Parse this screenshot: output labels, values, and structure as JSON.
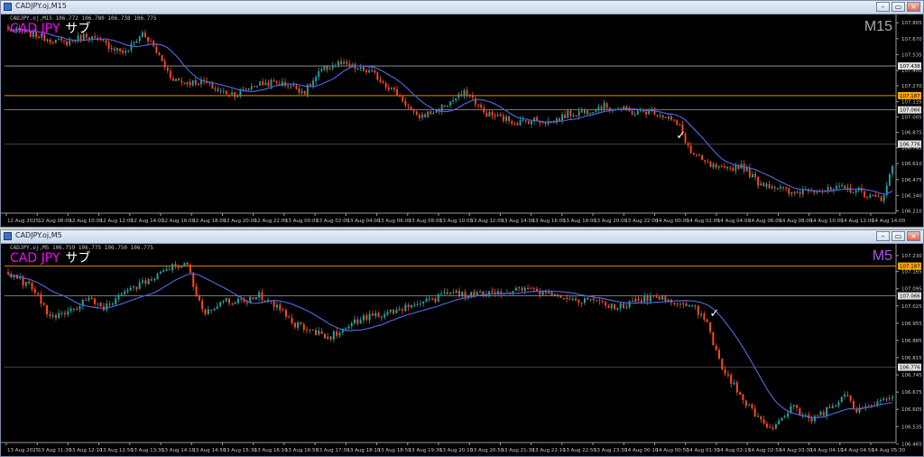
{
  "colors": {
    "bull": "#21a5a5",
    "bear": "#ff4a1a",
    "ma": "#4b63d8",
    "grid": "#3c3c3c",
    "axis": "#9a9a9a",
    "orange": "#ffa500",
    "white": "#e8e8e8",
    "axisText": "#c8c8c8"
  },
  "windows": [
    {
      "title": "CADJPY.oj,M15",
      "info": "CADJPY.oj,M15 106.772 106.780 106.738 106.775",
      "symbol": "CAD JPY",
      "symbol_sub": "サブ",
      "timeframe": "M15",
      "timeframe_color": "#aaaaaa",
      "buttons": [
        "–",
        "▭",
        "×"
      ],
      "chart_data": {
        "type": "candlestick",
        "ylim": [
          106.19,
          107.86
        ],
        "y_ticks": [
          107.805,
          107.67,
          107.535,
          107.4,
          107.27,
          107.135,
          107.005,
          106.875,
          106.745,
          106.61,
          106.475,
          106.34,
          106.21
        ],
        "x_ticks": [
          "12 Aug 2025",
          "12 Aug 08:00",
          "12 Aug 10:00",
          "12 Aug 12:00",
          "12 Aug 14:00",
          "12 Aug 16:00",
          "12 Aug 18:00",
          "12 Aug 20:00",
          "12 Aug 22:00",
          "13 Aug 00:00",
          "13 Aug 02:00",
          "13 Aug 04:00",
          "13 Aug 06:00",
          "13 Aug 08:00",
          "13 Aug 10:00",
          "13 Aug 12:00",
          "13 Aug 14:00",
          "13 Aug 16:00",
          "13 Aug 18:00",
          "13 Aug 20:00",
          "13 Aug 22:00",
          "14 Aug 00:00",
          "14 Aug 02:00",
          "14 Aug 04:00",
          "14 Aug 06:00",
          "14 Aug 08:00",
          "14 Aug 10:00",
          "14 Aug 12:00",
          "14 Aug 14:00"
        ],
        "hlines": [
          {
            "price": 107.438,
            "label": "107.438",
            "color": "white"
          },
          {
            "price": 107.187,
            "label": "107.187",
            "color": "orange"
          },
          {
            "price": 107.066,
            "label": "107.066",
            "color": "white"
          },
          {
            "price": 106.776,
            "label": "106.776",
            "color": "white"
          }
        ],
        "key_points": [
          [
            0,
            107.75
          ],
          [
            10,
            107.7
          ],
          [
            20,
            107.63
          ],
          [
            28,
            107.7
          ],
          [
            35,
            107.62
          ],
          [
            42,
            107.55
          ],
          [
            48,
            107.72
          ],
          [
            52,
            107.6
          ],
          [
            58,
            107.35
          ],
          [
            62,
            107.3
          ],
          [
            70,
            107.3
          ],
          [
            76,
            107.22
          ],
          [
            82,
            107.2
          ],
          [
            88,
            107.28
          ],
          [
            95,
            107.3
          ],
          [
            100,
            107.28
          ],
          [
            106,
            107.22
          ],
          [
            112,
            107.4
          ],
          [
            118,
            107.46
          ],
          [
            124,
            107.42
          ],
          [
            130,
            107.38
          ],
          [
            135,
            107.28
          ],
          [
            140,
            107.18
          ],
          [
            146,
            107.0
          ],
          [
            152,
            107.05
          ],
          [
            158,
            107.13
          ],
          [
            164,
            107.22
          ],
          [
            170,
            107.04
          ],
          [
            176,
            107.0
          ],
          [
            182,
            106.96
          ],
          [
            188,
            106.98
          ],
          [
            194,
            106.96
          ],
          [
            200,
            107.03
          ],
          [
            206,
            107.05
          ],
          [
            212,
            107.1
          ],
          [
            218,
            107.08
          ],
          [
            224,
            107.04
          ],
          [
            230,
            107.06
          ],
          [
            236,
            107.0
          ],
          [
            240,
            106.92
          ],
          [
            244,
            106.7
          ],
          [
            250,
            106.6
          ],
          [
            256,
            106.55
          ],
          [
            262,
            106.6
          ],
          [
            268,
            106.45
          ],
          [
            274,
            106.42
          ],
          [
            280,
            106.35
          ],
          [
            286,
            106.4
          ],
          [
            292,
            106.38
          ],
          [
            298,
            106.4
          ],
          [
            304,
            106.38
          ],
          [
            308,
            106.33
          ],
          [
            312,
            106.3
          ],
          [
            316,
            106.58
          ]
        ],
        "ma_period": 14
      },
      "checkmark": {
        "index": 240,
        "price": 106.82,
        "symbol": "✓"
      }
    },
    {
      "title": "CADJPY.oj,M5",
      "info": "CADJPY.oj,M5 106.759 106.775 106.750 106.775",
      "symbol": "CAD JPY",
      "symbol_sub": "サブ",
      "timeframe": "M5",
      "timeframe_color": "#a855f7",
      "buttons": [
        "–",
        "▭",
        "×"
      ],
      "chart_data": {
        "type": "candlestick",
        "ylim": [
          106.47,
          107.27
        ],
        "y_ticks": [
          107.23,
          107.165,
          107.095,
          107.025,
          106.955,
          106.885,
          106.815,
          106.745,
          106.675,
          106.605,
          106.535,
          106.465
        ],
        "x_ticks": [
          "13 Aug 2025",
          "13 Aug 11:30",
          "13 Aug 12:10",
          "13 Aug 12:50",
          "13 Aug 13:30",
          "13 Aug 14:10",
          "13 Aug 14:50",
          "13 Aug 15:30",
          "13 Aug 16:10",
          "13 Aug 16:50",
          "13 Aug 17:30",
          "13 Aug 18:10",
          "13 Aug 18:50",
          "13 Aug 19:30",
          "13 Aug 20:10",
          "13 Aug 20:50",
          "13 Aug 21:30",
          "13 Aug 22:10",
          "13 Aug 22:50",
          "13 Aug 23:30",
          "14 Aug 00:10",
          "14 Aug 00:50",
          "14 Aug 01:30",
          "14 Aug 02:10",
          "14 Aug 02:50",
          "14 Aug 03:30",
          "14 Aug 04:10",
          "14 Aug 04:50",
          "14 Aug 05:30"
        ],
        "hlines": [
          {
            "price": 107.187,
            "label": "107.187",
            "color": "orange"
          },
          {
            "price": 107.066,
            "label": "107.066",
            "color": "white"
          },
          {
            "price": 106.776,
            "label": "106.776",
            "color": "white"
          }
        ],
        "key_points": [
          [
            0,
            107.16
          ],
          [
            8,
            107.1
          ],
          [
            14,
            106.98
          ],
          [
            20,
            107.0
          ],
          [
            26,
            107.05
          ],
          [
            32,
            107.02
          ],
          [
            40,
            107.08
          ],
          [
            48,
            107.14
          ],
          [
            56,
            107.19
          ],
          [
            60,
            107.2
          ],
          [
            62,
            107.1
          ],
          [
            66,
            107.0
          ],
          [
            72,
            107.05
          ],
          [
            78,
            107.04
          ],
          [
            84,
            107.07
          ],
          [
            90,
            107.02
          ],
          [
            96,
            106.95
          ],
          [
            102,
            106.92
          ],
          [
            108,
            106.9
          ],
          [
            114,
            106.95
          ],
          [
            120,
            106.98
          ],
          [
            128,
            107.0
          ],
          [
            136,
            107.03
          ],
          [
            142,
            107.05
          ],
          [
            148,
            107.08
          ],
          [
            156,
            107.07
          ],
          [
            164,
            107.08
          ],
          [
            172,
            107.1
          ],
          [
            178,
            107.08
          ],
          [
            184,
            107.06
          ],
          [
            190,
            107.04
          ],
          [
            196,
            107.05
          ],
          [
            204,
            107.02
          ],
          [
            212,
            107.05
          ],
          [
            218,
            107.06
          ],
          [
            224,
            107.04
          ],
          [
            230,
            107.02
          ],
          [
            234,
            106.95
          ],
          [
            238,
            106.8
          ],
          [
            244,
            106.68
          ],
          [
            250,
            106.58
          ],
          [
            256,
            106.52
          ],
          [
            262,
            106.62
          ],
          [
            268,
            106.56
          ],
          [
            274,
            106.6
          ],
          [
            280,
            106.66
          ],
          [
            284,
            106.6
          ],
          [
            290,
            106.62
          ],
          [
            296,
            106.66
          ]
        ],
        "ma_period": 20
      },
      "checkmark": {
        "index": 236,
        "price": 106.98,
        "symbol": "✓"
      }
    }
  ]
}
